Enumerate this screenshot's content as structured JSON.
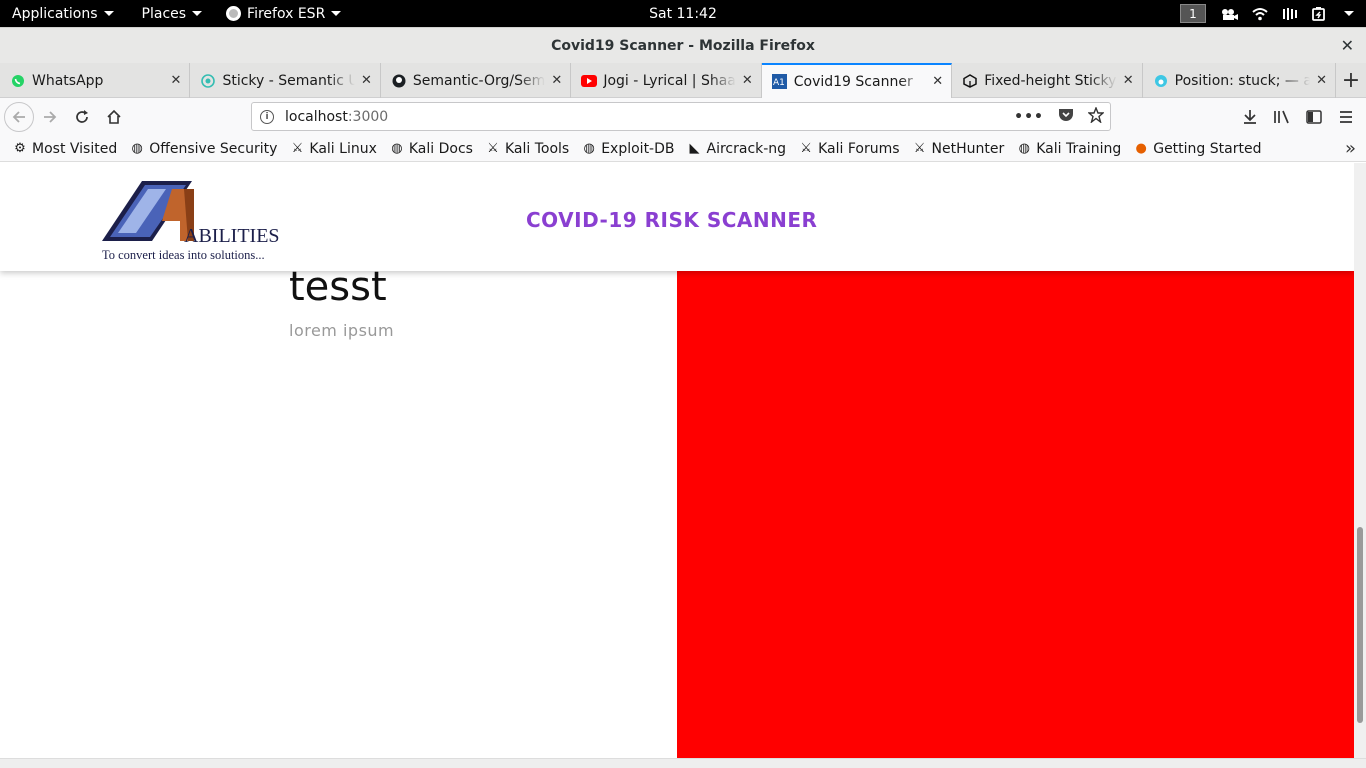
{
  "system": {
    "applications": "Applications",
    "places": "Places",
    "firefox": "Firefox ESR",
    "clock": "Sat 11:42",
    "workspace": "1"
  },
  "window": {
    "title": "Covid19 Scanner - Mozilla Firefox",
    "close": "✕"
  },
  "tabs": [
    {
      "title": "WhatsApp",
      "icon": "whatsapp-icon",
      "active": false
    },
    {
      "title": "Sticky - Semantic UI",
      "icon": "semantic-ui-icon",
      "active": false
    },
    {
      "title": "Semantic-Org/Semantic",
      "icon": "github-icon",
      "active": false
    },
    {
      "title": "Jogi - Lyrical | Shaadi",
      "icon": "youtube-icon",
      "active": false
    },
    {
      "title": "Covid19 Scanner",
      "icon": "a1-icon",
      "active": true
    },
    {
      "title": "Fixed-height Sticky",
      "icon": "codesandbox-icon",
      "active": false
    },
    {
      "title": "Position: stuck; — a",
      "icon": "css-tricks-icon",
      "active": false
    }
  ],
  "navbar": {
    "url_host": "localhost",
    "url_port": ":3000"
  },
  "bookmarks": [
    {
      "label": "Most Visited",
      "icon": "⚙"
    },
    {
      "label": "Offensive Security",
      "icon": "◍"
    },
    {
      "label": "Kali Linux",
      "icon": "⚔"
    },
    {
      "label": "Kali Docs",
      "icon": "◍"
    },
    {
      "label": "Kali Tools",
      "icon": "⚔"
    },
    {
      "label": "Exploit-DB",
      "icon": "◍"
    },
    {
      "label": "Aircrack-ng",
      "icon": "◣"
    },
    {
      "label": "Kali Forums",
      "icon": "⚔"
    },
    {
      "label": "NetHunter",
      "icon": "⚔"
    },
    {
      "label": "Kali Training",
      "icon": "◍"
    },
    {
      "label": "Getting Started",
      "icon": "●"
    }
  ],
  "page": {
    "logo_text": "ABILITIES",
    "logo_tagline": "To convert ideas into solutions...",
    "brand_title": "COVID-19 RISK SCANNER",
    "hero_title": "tesst",
    "hero_subtitle": "lorem ipsum"
  },
  "colors": {
    "brand": "#8a3fd1",
    "red_panel": "#ff0000",
    "active_tab": "#0a84ff"
  }
}
